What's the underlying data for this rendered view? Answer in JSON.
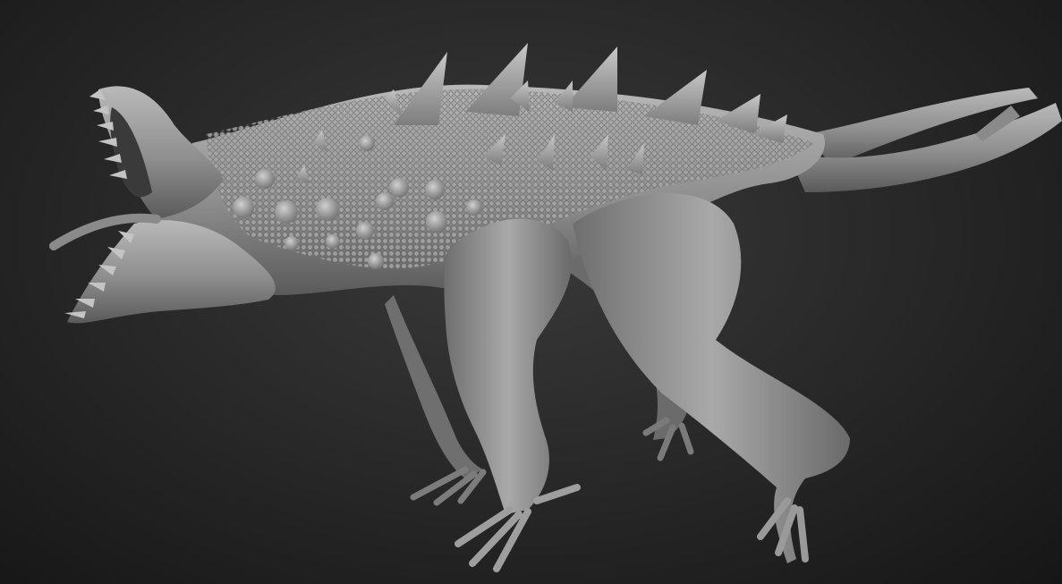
{
  "scene": {
    "subject": "sculpted-creature-model",
    "colors": {
      "background_center": "#3a3a3a",
      "background_edge": "#161616",
      "clay_light": "#bdbdbd",
      "clay_mid": "#8c8c8c",
      "clay_dark": "#555555"
    }
  }
}
